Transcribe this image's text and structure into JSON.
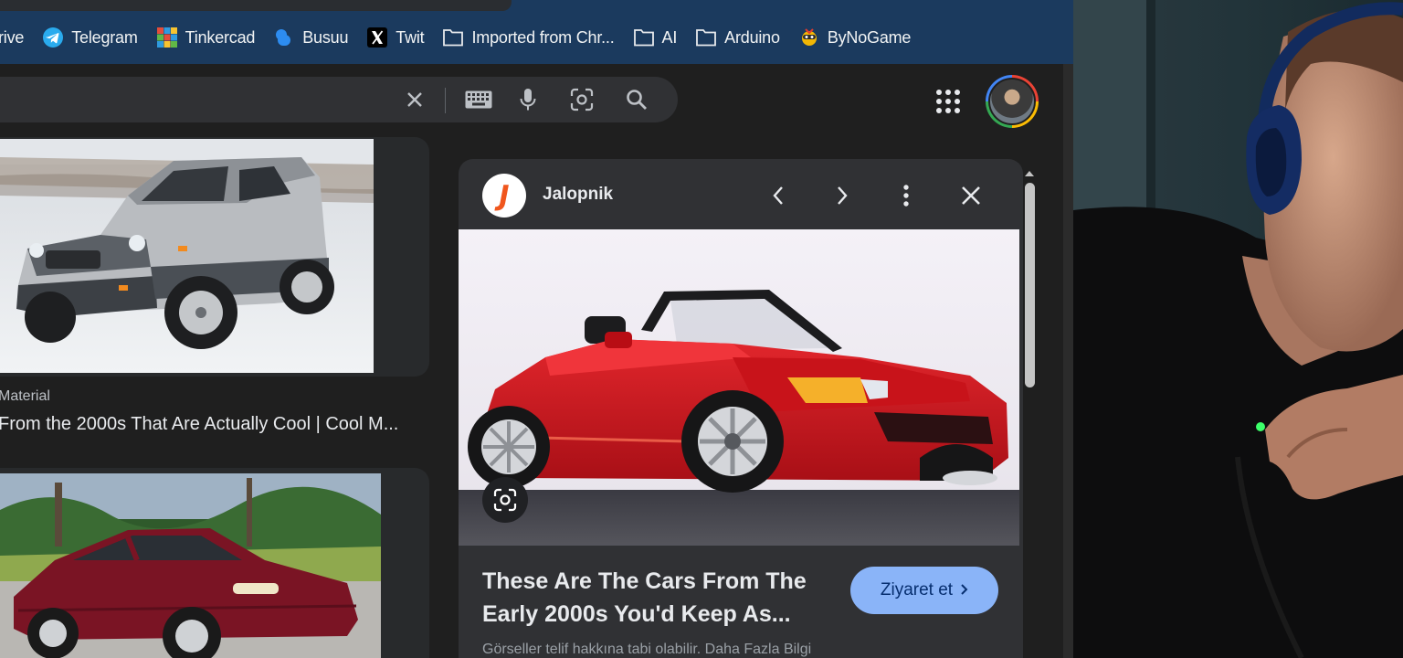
{
  "bookmarks": [
    {
      "label": "rive",
      "icon": "google-drive-icon"
    },
    {
      "label": "Telegram",
      "icon": "telegram-icon"
    },
    {
      "label": "Tinkercad",
      "icon": "tinkercad-icon"
    },
    {
      "label": "Busuu",
      "icon": "busuu-icon"
    },
    {
      "label": "Twit",
      "icon": "x-twitter-icon"
    },
    {
      "label": "Imported from Chr...",
      "icon": "folder-icon"
    },
    {
      "label": "AI",
      "icon": "folder-icon"
    },
    {
      "label": "Arduino",
      "icon": "folder-icon"
    },
    {
      "label": "ByNoGame",
      "icon": "bynogame-icon"
    }
  ],
  "search": {
    "clear_icon": "close-icon",
    "keyboard_icon": "keyboard-icon",
    "mic_icon": "microphone-icon",
    "lens_icon": "google-lens-icon",
    "search_icon": "search-icon"
  },
  "results": [
    {
      "source": "Material",
      "title": "From the 2000s That Are Actually Cool | Cool M..."
    }
  ],
  "preview": {
    "site_name": "Jalopnik",
    "logo_letter": "J",
    "title": "These Are The Cars From The Early 2000s You'd Keep As...",
    "visit_label": "Ziyaret et",
    "copyright_note": "Görseller telif hakkına tabi olabilir. Daha Fazla Bilgi"
  },
  "colors": {
    "bookmark_bar": "#1b3a5e",
    "page_bg": "#1f1f1f",
    "panel_bg": "#303134",
    "accent_button": "#8ab4f8",
    "jalopnik_orange": "#f0561d",
    "car_red": "#c8131a",
    "car_maroon": "#7a1424"
  }
}
